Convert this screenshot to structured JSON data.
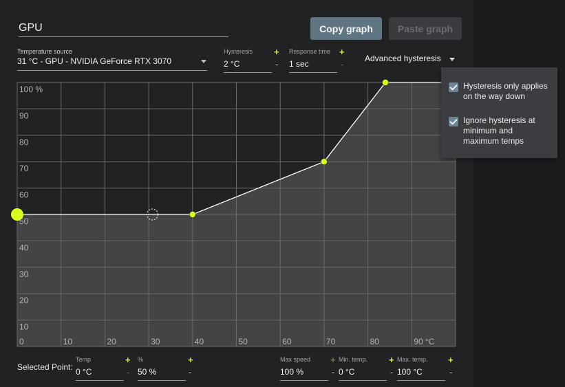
{
  "name_field": {
    "value": "GPU"
  },
  "buttons": {
    "copy": "Copy graph",
    "paste": "Paste graph"
  },
  "temperature_source": {
    "label": "Temperature source",
    "value": "31 °C - GPU - NVIDIA GeForce RTX 3070"
  },
  "hysteresis": {
    "label": "Hysteresis",
    "value": "2 °C",
    "plus": "+",
    "minus": "-"
  },
  "response_time": {
    "label": "Response time",
    "value": "1 sec",
    "plus": "+",
    "minus": "-"
  },
  "advanced_hysteresis": {
    "label": "Advanced hysteresis",
    "options": [
      {
        "label": "Hysteresis only applies on the way down",
        "checked": true
      },
      {
        "label": "Ignore hysteresis at minimum and maximum temps",
        "checked": true
      }
    ]
  },
  "chart_data": {
    "type": "line",
    "x": [
      0,
      40,
      70,
      84,
      100
    ],
    "y": [
      50,
      50,
      70,
      100,
      100
    ],
    "xlim": [
      0,
      100
    ],
    "ylim": [
      0,
      100
    ],
    "x_tick_labels": [
      "0",
      "10",
      "20",
      "30",
      "40",
      "50",
      "60",
      "70",
      "80",
      "90 °C"
    ],
    "y_tick_labels": [
      "10",
      "20",
      "30",
      "40",
      "50",
      "60",
      "70",
      "80",
      "90",
      "100 %"
    ],
    "control_points": [
      {
        "x": 0,
        "y": 50,
        "selected": true
      },
      {
        "x": 40,
        "y": 50
      },
      {
        "x": 70,
        "y": 70
      },
      {
        "x": 84,
        "y": 100
      }
    ],
    "current_temp_marker": {
      "x": 31,
      "y": 50
    },
    "line_color": "#ffffff",
    "point_color": "#d7ff1e",
    "fill_color": "#4a4a4b",
    "grid": true
  },
  "selected_point": {
    "label": "Selected Point:",
    "temp": {
      "label": "Temp",
      "value": "0 °C"
    },
    "percent": {
      "label": "%",
      "value": "50 %"
    }
  },
  "max_speed": {
    "label": "Max speed",
    "value": "100 %"
  },
  "min_temp": {
    "label": "Min. temp.",
    "value": "0 °C"
  },
  "max_temp": {
    "label": "Max. temp.",
    "value": "100 °C"
  },
  "symbols": {
    "plus": "+",
    "minus": "-"
  },
  "colors": {
    "accent": "#d7ff1e",
    "copy_button": "#607582",
    "checkbox": "#6e8595"
  }
}
